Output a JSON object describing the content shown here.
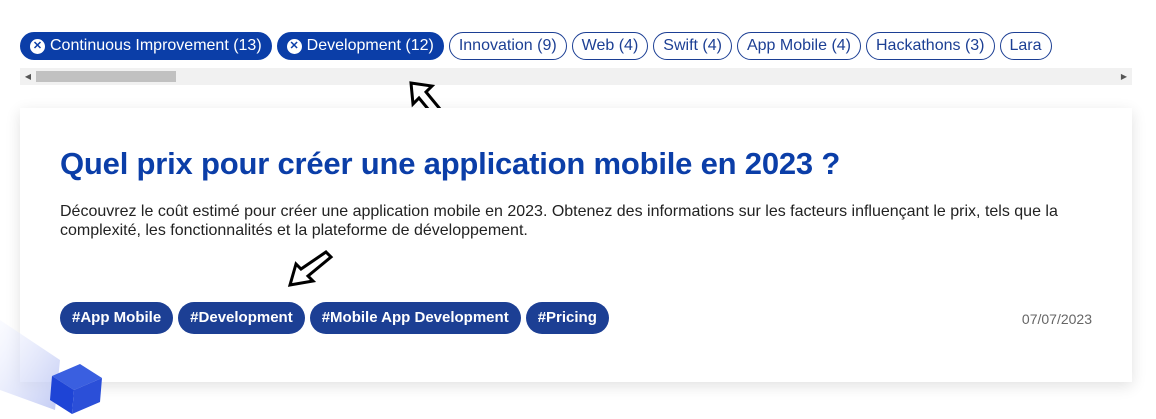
{
  "filters": {
    "active": [
      {
        "label": "Continuous Improvement (13)"
      },
      {
        "label": "Development (12)"
      }
    ],
    "inactive": [
      {
        "label": "Innovation (9)"
      },
      {
        "label": "Web (4)"
      },
      {
        "label": "Swift (4)"
      },
      {
        "label": "App Mobile (4)"
      },
      {
        "label": "Hackathons (3)"
      },
      {
        "label": "Lara"
      }
    ]
  },
  "scrollbar": {
    "left_arrow": "◀",
    "right_arrow": "▶"
  },
  "article": {
    "title": "Quel prix pour créer une application mobile en 2023 ?",
    "description": "Découvrez le coût estimé pour créer une application mobile en 2023. Obtenez des informations sur les facteurs influençant le prix, tels que la complexité, les fonctionnalités et la plateforme de développement.",
    "tags": [
      "#App Mobile",
      "#Development",
      "#Mobile App Development",
      "#Pricing"
    ],
    "date": "07/07/2023"
  },
  "icons": {
    "remove": "close-icon",
    "pointer": "cursor-arrow-icon",
    "decor": "cube-icon"
  },
  "colors": {
    "primary": "#0b3ea8",
    "tag": "#1c3f94"
  }
}
